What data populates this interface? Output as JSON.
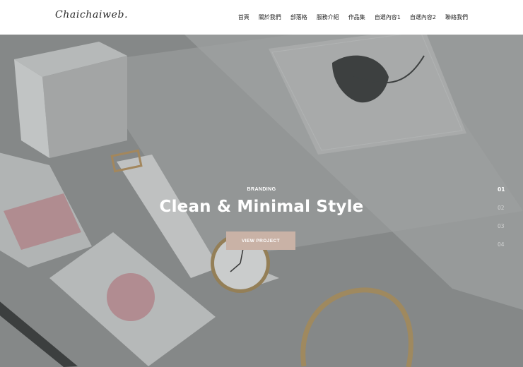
{
  "brand": {
    "logo": "Chaichaiweb."
  },
  "nav": {
    "items": [
      {
        "label": "首頁"
      },
      {
        "label": "關於我們"
      },
      {
        "label": "部落格"
      },
      {
        "label": "服務介紹"
      },
      {
        "label": "作品集"
      },
      {
        "label": "自選內容1"
      },
      {
        "label": "自選內容2"
      },
      {
        "label": "聯絡我們"
      }
    ]
  },
  "hero": {
    "eyebrow": "BRANDING",
    "headline": "Clean & Minimal Style",
    "cta_label": "VIEW PROJECT",
    "slides": [
      {
        "label": "01",
        "active": true
      },
      {
        "label": "02",
        "active": false
      },
      {
        "label": "03",
        "active": false
      },
      {
        "label": "04",
        "active": false
      }
    ],
    "colors": {
      "cta": "#c9b2a6",
      "overlay_text": "#ffffff"
    }
  }
}
